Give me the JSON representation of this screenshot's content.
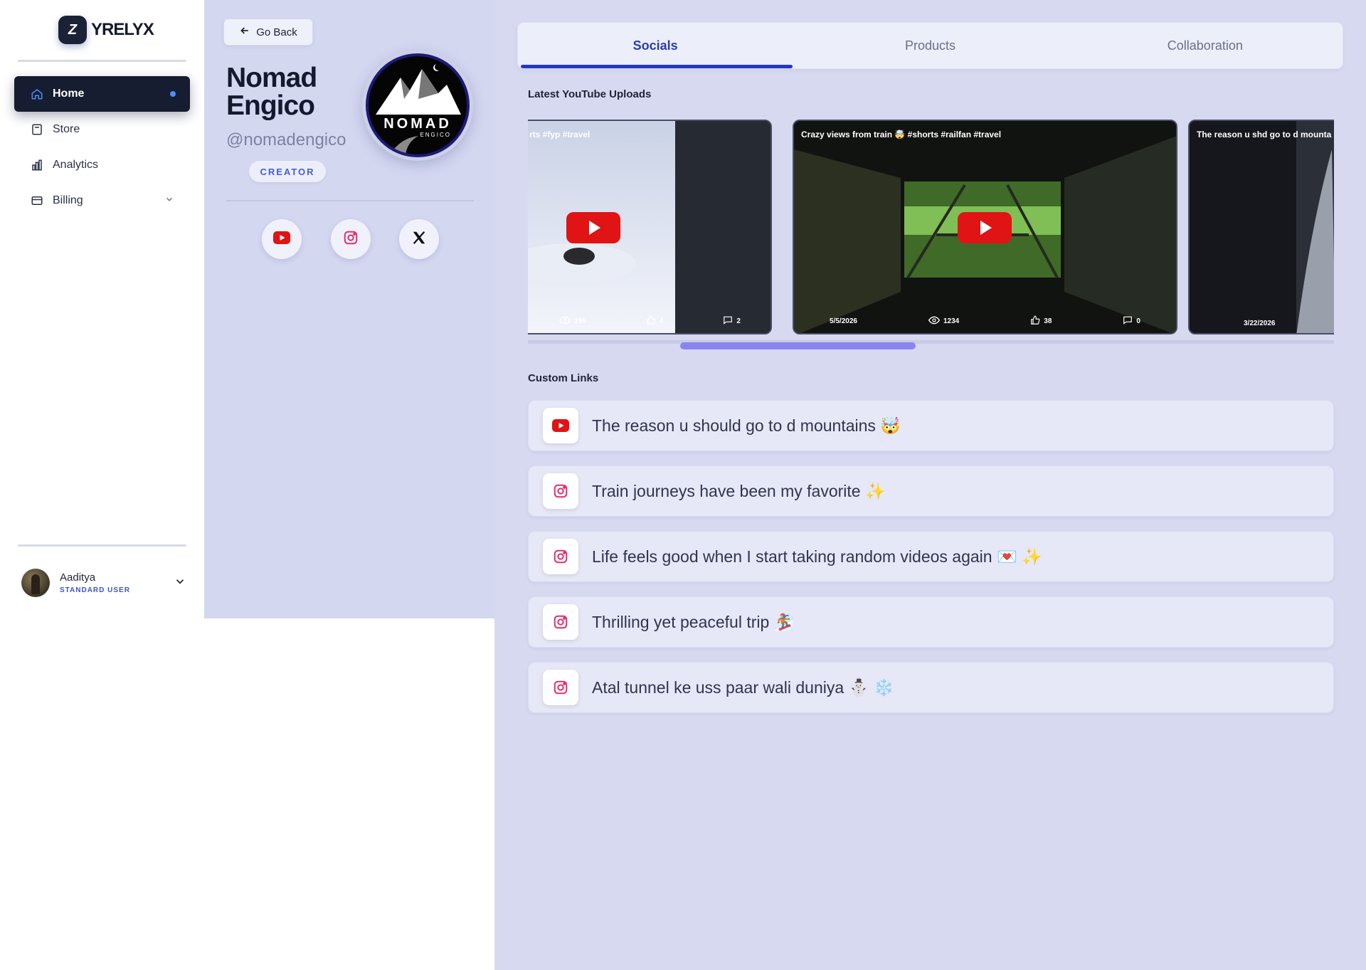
{
  "app": {
    "logo_mark": "Z",
    "logo_text": "YRELYX"
  },
  "sidebar": {
    "items": [
      {
        "label": "Home",
        "icon": "home-icon",
        "active": true
      },
      {
        "label": "Store",
        "icon": "store-icon"
      },
      {
        "label": "Analytics",
        "icon": "analytics-icon"
      },
      {
        "label": "Billing",
        "icon": "billing-icon",
        "has_submenu": true
      }
    ],
    "user": {
      "name": "Aaditya",
      "role": "STANDARD USER"
    }
  },
  "profile": {
    "back_label": "Go Back",
    "name": "Nomad Engico",
    "handle": "@nomadengico",
    "badge": "CREATOR",
    "logo_word": "NOMAD",
    "logo_sub": "ENGICO",
    "socials": [
      "youtube-icon",
      "instagram-icon",
      "x-icon"
    ]
  },
  "tabs": [
    {
      "label": "Socials",
      "active": true
    },
    {
      "label": "Products"
    },
    {
      "label": "Collaboration"
    }
  ],
  "youtube": {
    "heading": "Latest YouTube Uploads",
    "videos": [
      {
        "title": "rts #fyp #travel",
        "date": "",
        "views": "195",
        "likes": "4",
        "comments": "2"
      },
      {
        "title": "Crazy views from train 🤯 #shorts #railfan #travel",
        "date": "5/5/2026",
        "views": "1234",
        "likes": "38",
        "comments": "0"
      },
      {
        "title": "The reason u shd go to d mounta",
        "date": "3/22/2026",
        "views": "",
        "likes": "",
        "comments": ""
      }
    ]
  },
  "custom_links": {
    "heading": "Custom Links",
    "items": [
      {
        "platform": "youtube",
        "text": "The reason u should go to d mountains 🤯"
      },
      {
        "platform": "instagram",
        "text": "Train journeys have been my favorite ✨"
      },
      {
        "platform": "instagram",
        "text": "Life feels good when I start taking random videos again 💌 ✨"
      },
      {
        "platform": "instagram",
        "text": "Thrilling yet peaceful trip 🏂"
      },
      {
        "platform": "instagram",
        "text": "Atal tunnel ke uss paar wali duniya ⛄ ❄️"
      }
    ]
  },
  "colors": {
    "accent": "#2338c2",
    "youtube": "#e01414",
    "instagram": "#e1306c",
    "active_nav": "#161d30"
  }
}
